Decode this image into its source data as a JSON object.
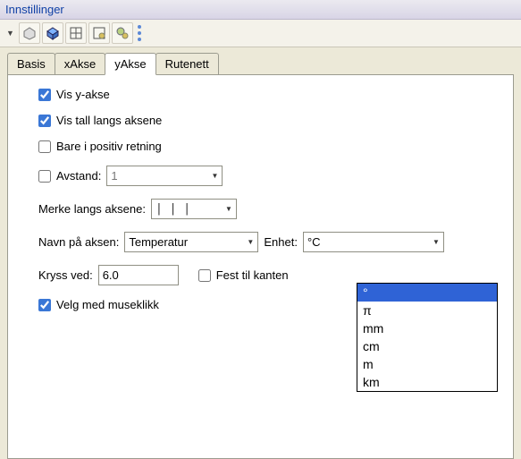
{
  "window": {
    "title": "Innstillinger"
  },
  "toolbar": {
    "icons": [
      "shape-icon",
      "shape-3d-icon",
      "grid-icon",
      "grid-gear-icon",
      "gears-icon"
    ]
  },
  "tabs": {
    "items": [
      {
        "label": "Basis",
        "active": false
      },
      {
        "label": "xAkse",
        "active": false
      },
      {
        "label": "yAkse",
        "active": true
      },
      {
        "label": "Rutenett",
        "active": false
      }
    ]
  },
  "panel": {
    "show_yaxis": {
      "label": "Vis y-akse",
      "checked": true
    },
    "show_numbers": {
      "label": "Vis tall langs aksene",
      "checked": true
    },
    "positive_only": {
      "label": "Bare i positiv retning",
      "checked": false
    },
    "distance": {
      "label": "Avstand:",
      "checked": false,
      "value": "1"
    },
    "ticks": {
      "label": "Merke langs aksene:",
      "preview": "|   |   |"
    },
    "axis_name": {
      "label": "Navn på aksen:",
      "value": "Temperatur"
    },
    "unit": {
      "label": "Enhet:",
      "value": "°C"
    },
    "cross_at": {
      "label": "Kryss ved:",
      "value": "6.0"
    },
    "snap_edge": {
      "label": "Fest til kanten",
      "checked": false
    },
    "mouse_select": {
      "label": "Velg med museklikk",
      "checked": true
    }
  },
  "unit_dropdown": {
    "options": [
      "°",
      "π",
      "mm",
      "cm",
      "m",
      "km"
    ],
    "selected_index": 0
  }
}
